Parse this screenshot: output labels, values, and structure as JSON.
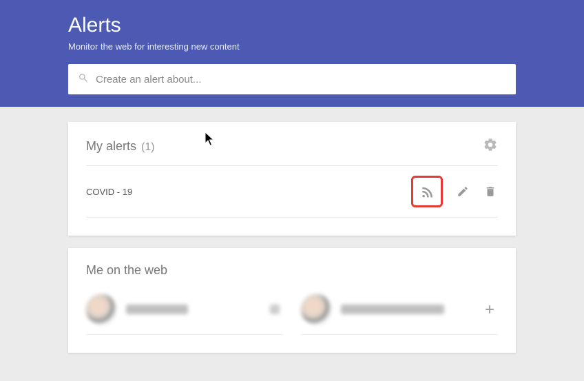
{
  "header": {
    "title": "Alerts",
    "subtitle": "Monitor the web for interesting new content"
  },
  "search": {
    "placeholder": "Create an alert about..."
  },
  "my_alerts": {
    "title": "My alerts",
    "count": "(1)",
    "items": [
      {
        "name": "COVID - 19"
      }
    ]
  },
  "me_on_web": {
    "title": "Me on the web"
  }
}
